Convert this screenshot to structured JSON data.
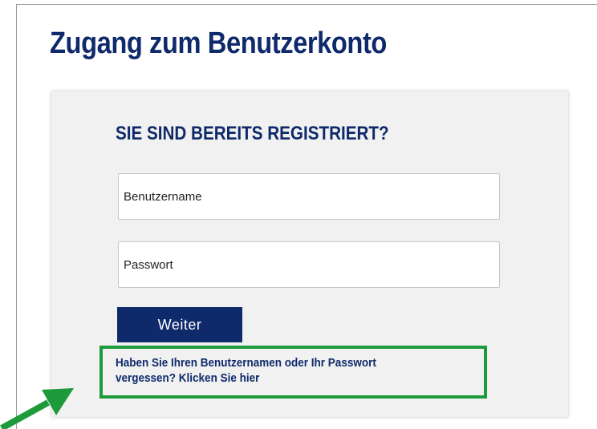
{
  "page": {
    "title": "Zugang zum Benutzerkonto"
  },
  "login": {
    "heading": "SIE SIND BEREITS REGISTRIERT?",
    "username_placeholder": "Benutzername",
    "password_placeholder": "Passwort",
    "submit_label": "Weiter",
    "forgot_line1": "Haben Sie Ihren Benutzernamen oder Ihr Passwort",
    "forgot_line2": "vergessen? Klicken Sie hier"
  },
  "annotation": {
    "highlight_color": "#1e9a3a",
    "arrow_icon": "arrow-up-right-icon"
  },
  "colors": {
    "brand_navy": "#0f2a6b",
    "panel_bg": "#f1f1f1"
  }
}
